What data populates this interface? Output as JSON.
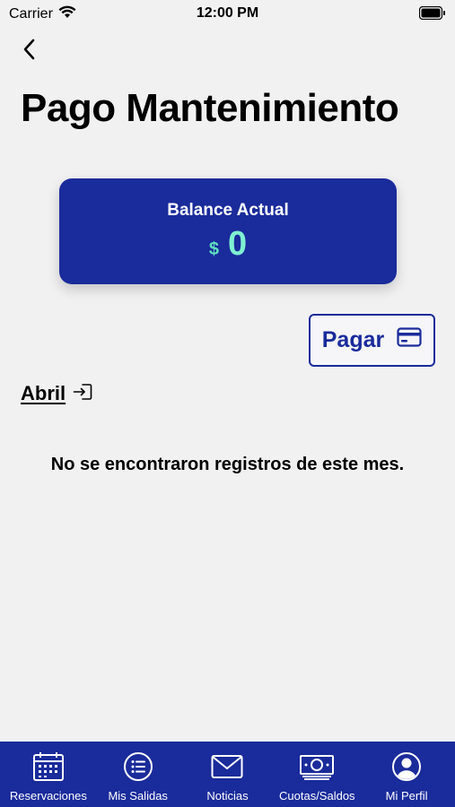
{
  "status_bar": {
    "carrier": "Carrier",
    "time": "12:00 PM"
  },
  "header": {
    "title": "Pago Mantenimiento"
  },
  "balance": {
    "label": "Balance Actual",
    "currency": "$",
    "value": "0"
  },
  "pay_button": {
    "label": "Pagar"
  },
  "month": {
    "label": "Abril"
  },
  "empty_message": "No se encontraron registros de este mes.",
  "tab_bar": {
    "items": [
      {
        "label": "Reservaciones",
        "icon": "calendar-icon"
      },
      {
        "label": "Mis Salidas",
        "icon": "list-icon"
      },
      {
        "label": "Noticias",
        "icon": "mail-icon"
      },
      {
        "label": "Cuotas/Saldos",
        "icon": "cash-icon"
      },
      {
        "label": "Mi Perfil",
        "icon": "profile-icon"
      }
    ]
  },
  "colors": {
    "primary": "#1a2b9b",
    "accent": "#7ff0d2",
    "background": "#f1f1f2"
  }
}
